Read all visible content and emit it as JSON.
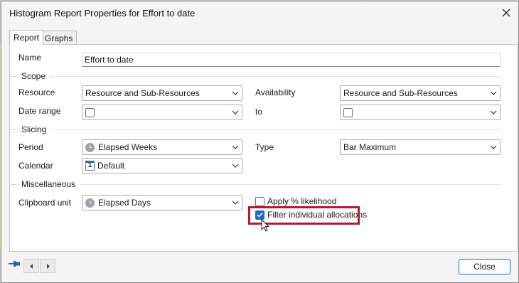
{
  "window": {
    "title": "Histogram Report Properties for Effort to date"
  },
  "tabs": [
    {
      "label": "Report"
    },
    {
      "label": "Graphs"
    }
  ],
  "name_field": {
    "label": "Name",
    "value": "Effort to date"
  },
  "scope": {
    "heading": "Scope",
    "resource_label": "Resource",
    "resource_value": "Resource and Sub-Resources",
    "availability_label": "Availability",
    "availability_value": "Resource and Sub-Resources",
    "date_range_label": "Date range",
    "to_label": "to"
  },
  "slicing": {
    "heading": "Slicing",
    "period_label": "Period",
    "period_value": "Elapsed Weeks",
    "type_label": "Type",
    "type_value": "Bar Maximum",
    "calendar_label": "Calendar",
    "calendar_value": "Default",
    "calendar_icon_text": "1"
  },
  "misc": {
    "heading": "Miscellaneous",
    "clipboard_label": "Clipboard unit",
    "clipboard_value": "Elapsed Days",
    "apply_likelihood_label": "Apply % likelihood",
    "apply_likelihood_checked": false,
    "filter_allocations_label": "Filter individual allocations",
    "filter_allocations_checked": true
  },
  "footer": {
    "close_label": "Close"
  },
  "colors": {
    "accent": "#1a6fc4",
    "highlight": "#b01c2e"
  }
}
